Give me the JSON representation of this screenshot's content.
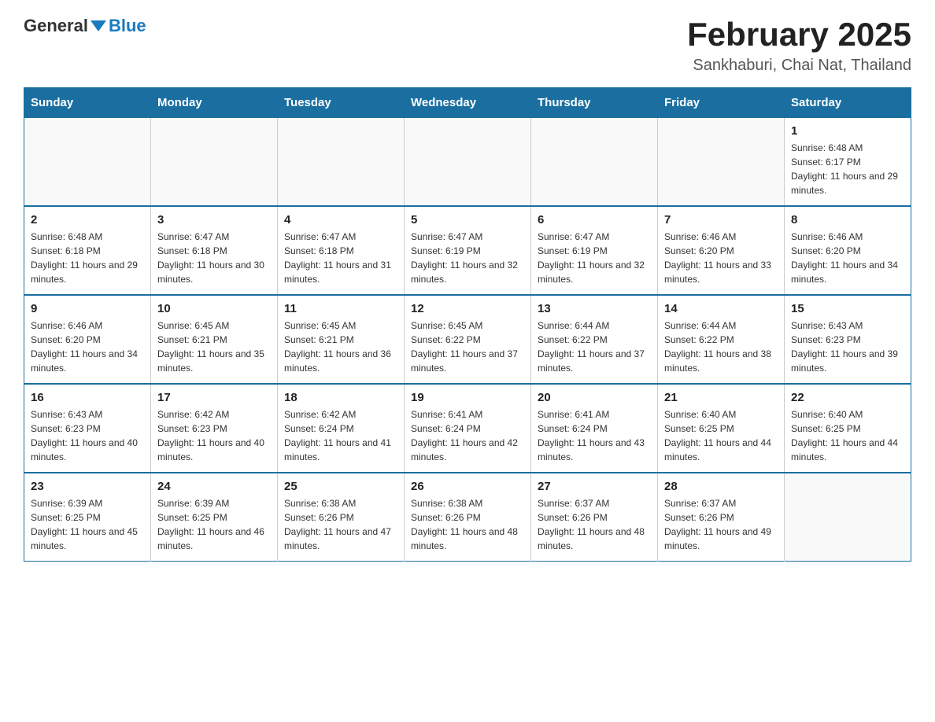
{
  "header": {
    "logo_general": "General",
    "logo_blue": "Blue",
    "main_title": "February 2025",
    "subtitle": "Sankhaburi, Chai Nat, Thailand"
  },
  "days_of_week": [
    "Sunday",
    "Monday",
    "Tuesday",
    "Wednesday",
    "Thursday",
    "Friday",
    "Saturday"
  ],
  "weeks": [
    [
      {
        "day": "",
        "info": ""
      },
      {
        "day": "",
        "info": ""
      },
      {
        "day": "",
        "info": ""
      },
      {
        "day": "",
        "info": ""
      },
      {
        "day": "",
        "info": ""
      },
      {
        "day": "",
        "info": ""
      },
      {
        "day": "1",
        "info": "Sunrise: 6:48 AM\nSunset: 6:17 PM\nDaylight: 11 hours and 29 minutes."
      }
    ],
    [
      {
        "day": "2",
        "info": "Sunrise: 6:48 AM\nSunset: 6:18 PM\nDaylight: 11 hours and 29 minutes."
      },
      {
        "day": "3",
        "info": "Sunrise: 6:47 AM\nSunset: 6:18 PM\nDaylight: 11 hours and 30 minutes."
      },
      {
        "day": "4",
        "info": "Sunrise: 6:47 AM\nSunset: 6:18 PM\nDaylight: 11 hours and 31 minutes."
      },
      {
        "day": "5",
        "info": "Sunrise: 6:47 AM\nSunset: 6:19 PM\nDaylight: 11 hours and 32 minutes."
      },
      {
        "day": "6",
        "info": "Sunrise: 6:47 AM\nSunset: 6:19 PM\nDaylight: 11 hours and 32 minutes."
      },
      {
        "day": "7",
        "info": "Sunrise: 6:46 AM\nSunset: 6:20 PM\nDaylight: 11 hours and 33 minutes."
      },
      {
        "day": "8",
        "info": "Sunrise: 6:46 AM\nSunset: 6:20 PM\nDaylight: 11 hours and 34 minutes."
      }
    ],
    [
      {
        "day": "9",
        "info": "Sunrise: 6:46 AM\nSunset: 6:20 PM\nDaylight: 11 hours and 34 minutes."
      },
      {
        "day": "10",
        "info": "Sunrise: 6:45 AM\nSunset: 6:21 PM\nDaylight: 11 hours and 35 minutes."
      },
      {
        "day": "11",
        "info": "Sunrise: 6:45 AM\nSunset: 6:21 PM\nDaylight: 11 hours and 36 minutes."
      },
      {
        "day": "12",
        "info": "Sunrise: 6:45 AM\nSunset: 6:22 PM\nDaylight: 11 hours and 37 minutes."
      },
      {
        "day": "13",
        "info": "Sunrise: 6:44 AM\nSunset: 6:22 PM\nDaylight: 11 hours and 37 minutes."
      },
      {
        "day": "14",
        "info": "Sunrise: 6:44 AM\nSunset: 6:22 PM\nDaylight: 11 hours and 38 minutes."
      },
      {
        "day": "15",
        "info": "Sunrise: 6:43 AM\nSunset: 6:23 PM\nDaylight: 11 hours and 39 minutes."
      }
    ],
    [
      {
        "day": "16",
        "info": "Sunrise: 6:43 AM\nSunset: 6:23 PM\nDaylight: 11 hours and 40 minutes."
      },
      {
        "day": "17",
        "info": "Sunrise: 6:42 AM\nSunset: 6:23 PM\nDaylight: 11 hours and 40 minutes."
      },
      {
        "day": "18",
        "info": "Sunrise: 6:42 AM\nSunset: 6:24 PM\nDaylight: 11 hours and 41 minutes."
      },
      {
        "day": "19",
        "info": "Sunrise: 6:41 AM\nSunset: 6:24 PM\nDaylight: 11 hours and 42 minutes."
      },
      {
        "day": "20",
        "info": "Sunrise: 6:41 AM\nSunset: 6:24 PM\nDaylight: 11 hours and 43 minutes."
      },
      {
        "day": "21",
        "info": "Sunrise: 6:40 AM\nSunset: 6:25 PM\nDaylight: 11 hours and 44 minutes."
      },
      {
        "day": "22",
        "info": "Sunrise: 6:40 AM\nSunset: 6:25 PM\nDaylight: 11 hours and 44 minutes."
      }
    ],
    [
      {
        "day": "23",
        "info": "Sunrise: 6:39 AM\nSunset: 6:25 PM\nDaylight: 11 hours and 45 minutes."
      },
      {
        "day": "24",
        "info": "Sunrise: 6:39 AM\nSunset: 6:25 PM\nDaylight: 11 hours and 46 minutes."
      },
      {
        "day": "25",
        "info": "Sunrise: 6:38 AM\nSunset: 6:26 PM\nDaylight: 11 hours and 47 minutes."
      },
      {
        "day": "26",
        "info": "Sunrise: 6:38 AM\nSunset: 6:26 PM\nDaylight: 11 hours and 48 minutes."
      },
      {
        "day": "27",
        "info": "Sunrise: 6:37 AM\nSunset: 6:26 PM\nDaylight: 11 hours and 48 minutes."
      },
      {
        "day": "28",
        "info": "Sunrise: 6:37 AM\nSunset: 6:26 PM\nDaylight: 11 hours and 49 minutes."
      },
      {
        "day": "",
        "info": ""
      }
    ]
  ]
}
